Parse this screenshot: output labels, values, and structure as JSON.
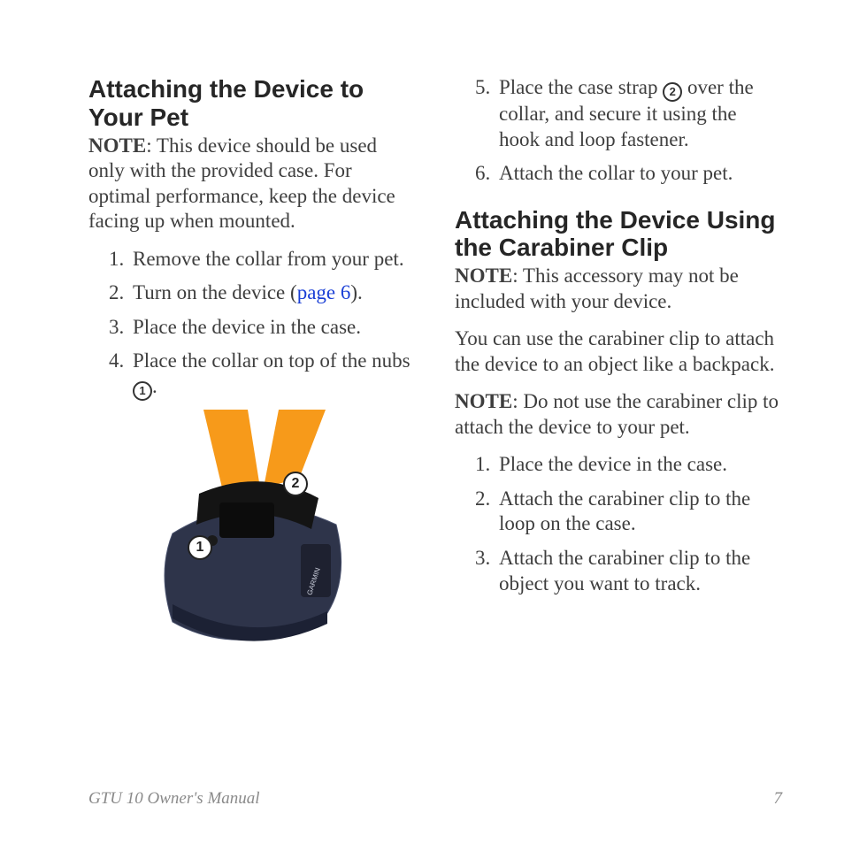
{
  "left": {
    "heading": "Attaching the Device to Your Pet",
    "note_label": "NOTE",
    "note_text": ": This device should be used only with the provided case. For optimal performance, keep the device facing up when mounted.",
    "steps": {
      "s1": "Remove the collar from your pet.",
      "s2a": "Turn on the device (",
      "s2link": "page 6",
      "s2b": ").",
      "s3": "Place the device in the case.",
      "s4a": "Place the collar on top of the nubs ",
      "s4b": "."
    },
    "callout1": "1",
    "callout2": "2"
  },
  "right": {
    "cont": {
      "s5a": "Place the case strap ",
      "s5b": " over the collar, and secure it using the hook and loop fastener.",
      "s6": "Attach the collar to your pet."
    },
    "heading": "Attaching the Device Using the Carabiner Clip",
    "note1_label": "NOTE",
    "note1_text": ": This accessory may not be included with your device.",
    "para": "You can use the carabiner clip to attach the device to an object like a backpack.",
    "note2_label": "NOTE",
    "note2_text": ": Do not use the carabiner clip to attach the device to your pet.",
    "steps": {
      "s1": "Place the device in the case.",
      "s2": "Attach the carabiner clip to the loop on the case.",
      "s3": "Attach the carabiner clip to the object you want to track."
    }
  },
  "footer": {
    "left": "GTU 10 Owner's Manual",
    "right": "7"
  },
  "circ1": "1",
  "circ2": "2"
}
